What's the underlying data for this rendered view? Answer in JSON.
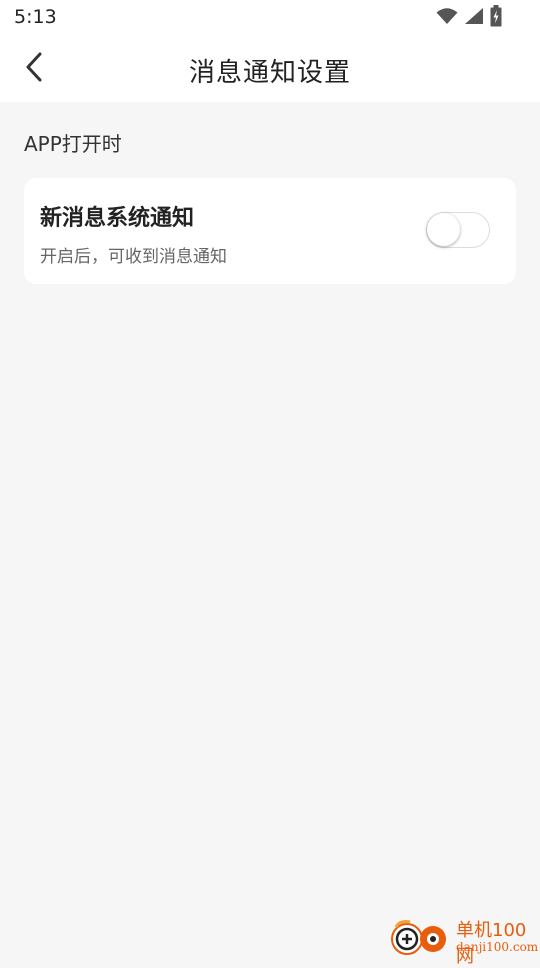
{
  "status_bar": {
    "time": "5:13",
    "icons": [
      "wifi-icon",
      "cellular-signal-icon",
      "battery-charging-icon"
    ]
  },
  "nav": {
    "title": "消息通知设置",
    "back_icon": "chevron-left-icon"
  },
  "section": {
    "header": "APP打开时"
  },
  "setting": {
    "title": "新消息系统通知",
    "description": "开启后，可收到消息通知",
    "enabled": false
  },
  "watermark": {
    "name": "单机100网",
    "url": "danji100.com"
  },
  "colors": {
    "background": "#f6f6f6",
    "card": "#ffffff",
    "watermark": "#e85d0c"
  }
}
